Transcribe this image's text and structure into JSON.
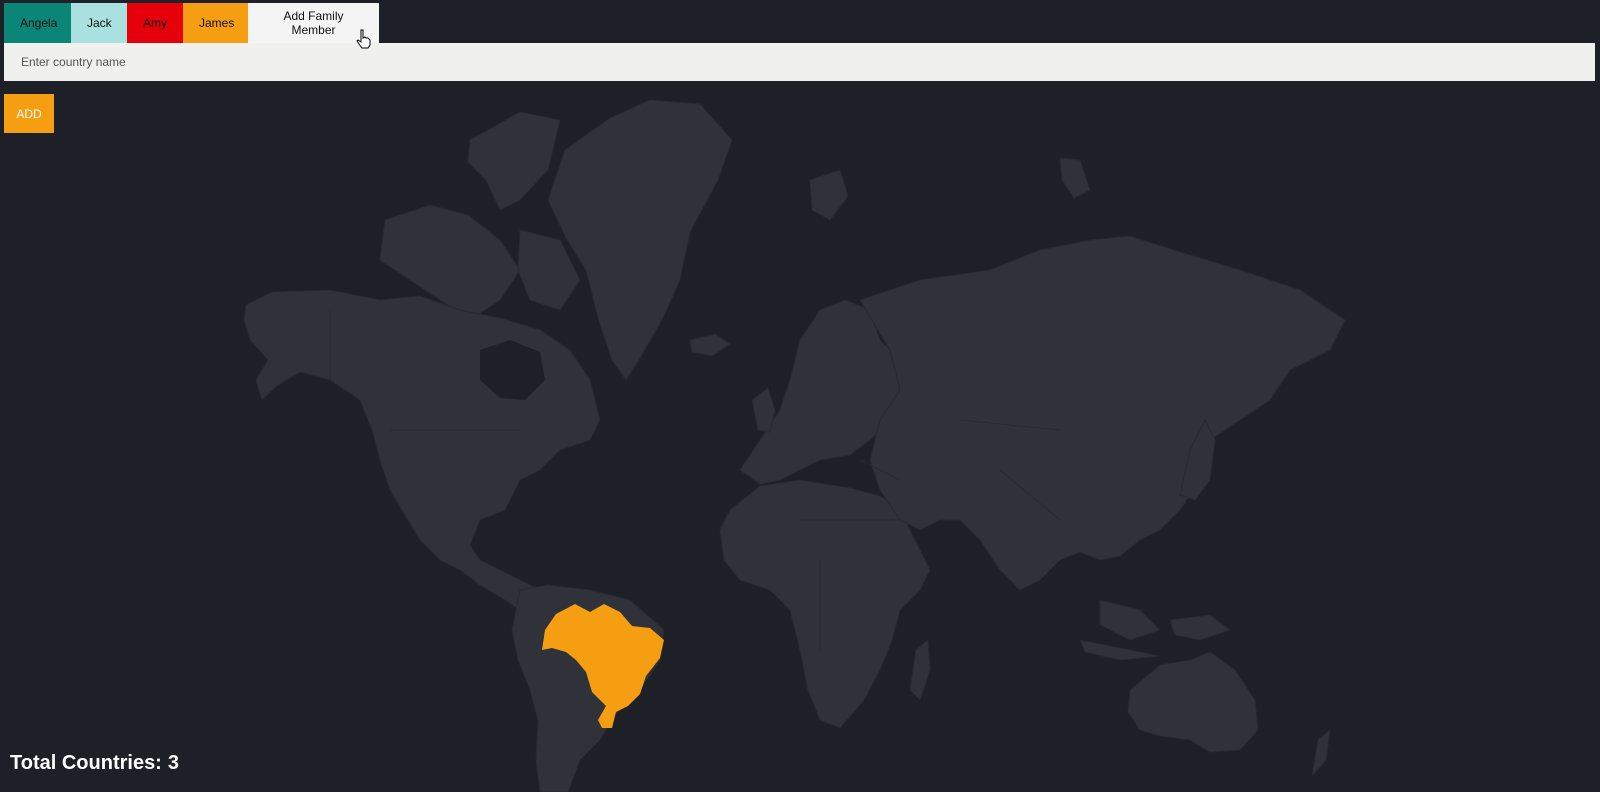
{
  "tabs": [
    {
      "label": "Angela",
      "color": "#0b8577"
    },
    {
      "label": "Jack",
      "color": "#a9e0e0"
    },
    {
      "label": "Amy",
      "color": "#e5000b"
    },
    {
      "label": "James",
      "color": "#f59e12"
    },
    {
      "label": "Add Family Member",
      "color": "#f4f4f4"
    }
  ],
  "form": {
    "country_placeholder": "Enter country name",
    "country_value": "",
    "add_label": "ADD",
    "add_color": "#f59e12"
  },
  "map": {
    "highlighted_country": "Brazil",
    "highlight_color": "#f59e12",
    "land_color": "#2f3239",
    "background_color": "#1d2026"
  },
  "footer": {
    "total_label": "Total Countries:",
    "total_count": "3"
  },
  "cursor": {
    "icon": "hand-pointer-icon"
  }
}
